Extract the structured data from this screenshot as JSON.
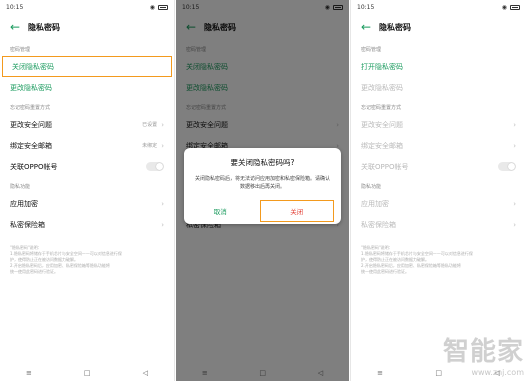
{
  "status": {
    "time": "10:15"
  },
  "page_title": "隐私密码",
  "section_password": "密码管理",
  "section_recovery": "忘记密码重置方式",
  "section_features": "隐私功能",
  "left": {
    "close_label": "关闭隐私密码",
    "change_label": "更改隐私密码",
    "security_q": "更改安全问题",
    "security_q_value": "已设置",
    "bind_email": "绑定安全邮箱",
    "bind_email_value": "未绑定",
    "oppo": "关联OPPO帐号",
    "app_lock": "应用加密",
    "safe_box": "私密保险箱"
  },
  "right": {
    "open_label": "打开隐私密码",
    "change_label": "更改隐私密码"
  },
  "dialog": {
    "title": "要关闭隐私密码吗?",
    "body": "关闭隐私密码后，将无法访问应用加密和私密保险箱。请确认数据移出后再关闭。",
    "cancel": "取消",
    "confirm": "关闭"
  },
  "note_lines": [
    "\"隐私密码\"说明：",
    "1.隐私密码将储存于手机芯片与安全空间——可以对信息进行保",
    "护，使得防止正在被访问数据力破解。",
    "2.开启隐私密码后，应用加密、私密保险箱等隐私功能将",
    "统一使用此密码进行验证。"
  ],
  "nav": {
    "menu": "≡",
    "home": "□",
    "back": "◁"
  },
  "watermark": {
    "logo": "智能家",
    "url": "www.znj.com"
  },
  "colors": {
    "accent": "#1a9b5e",
    "highlight": "#f39a1e",
    "danger": "#e3463d"
  }
}
